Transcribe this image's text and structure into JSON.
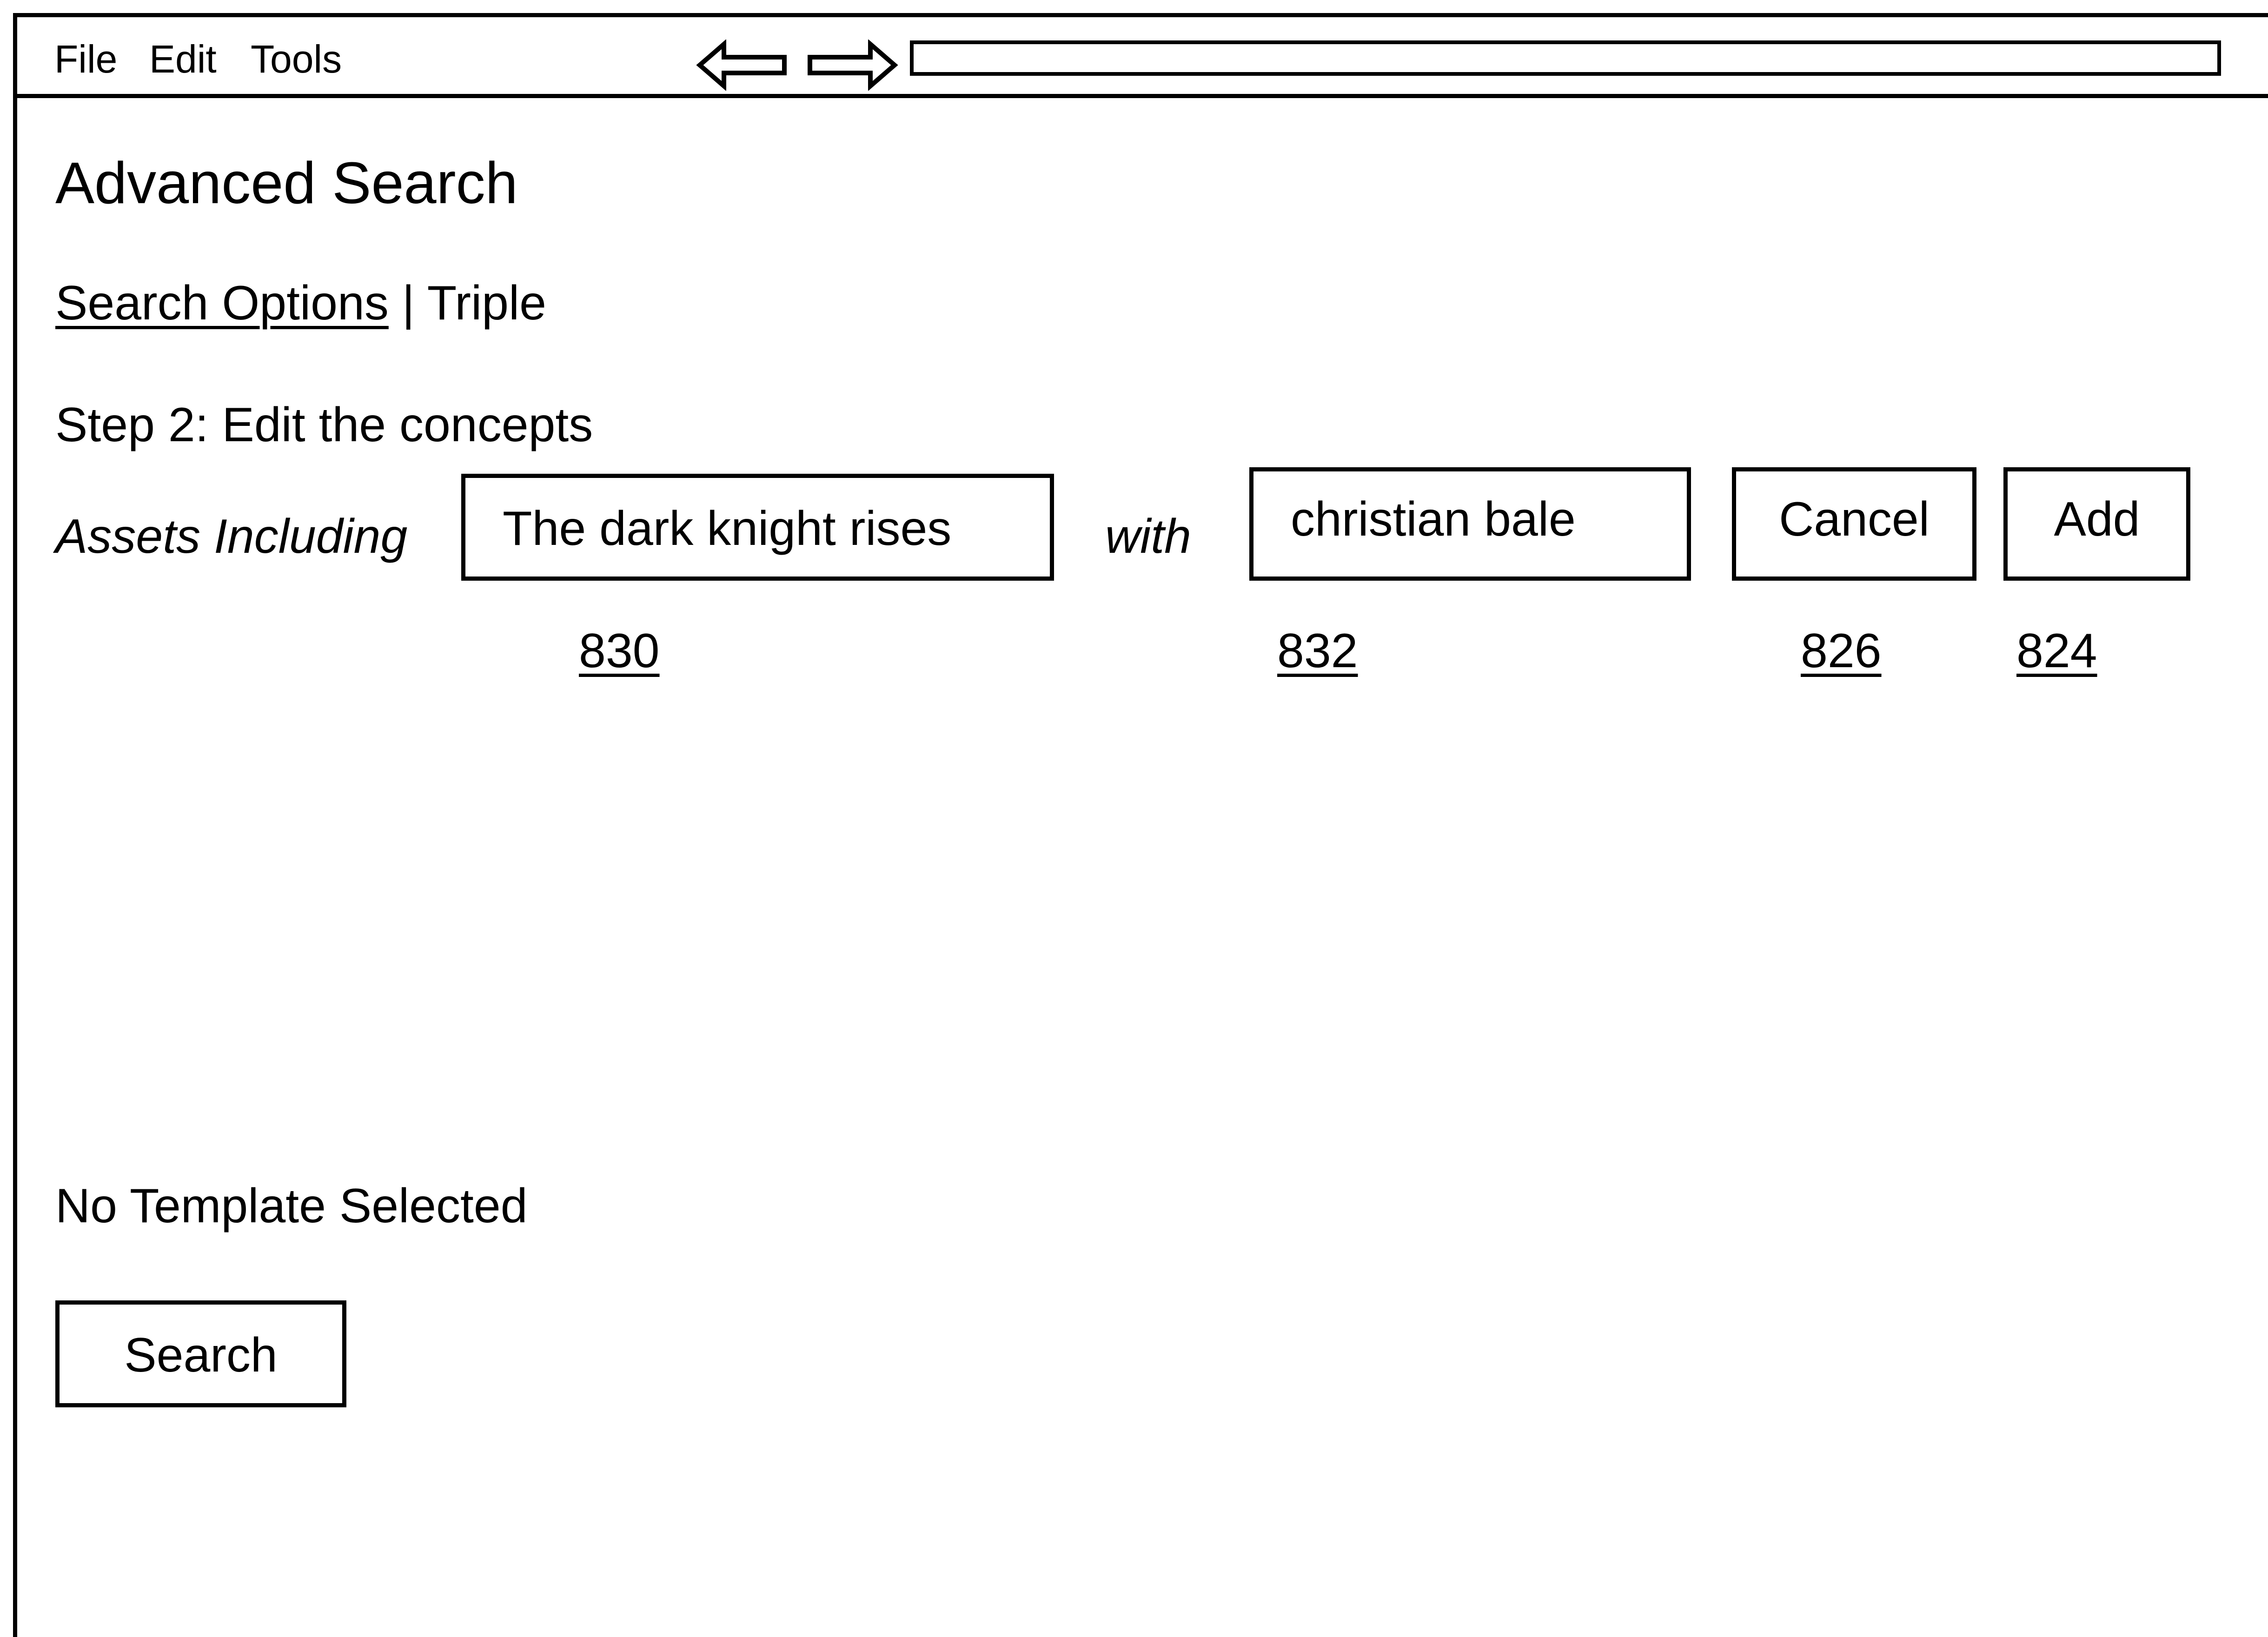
{
  "menubar": {
    "items": [
      "File",
      "Edit",
      "Tools"
    ],
    "back_icon": "left-arrow-icon",
    "forward_icon": "right-arrow-icon",
    "address_value": ""
  },
  "page": {
    "title": "Advanced Search",
    "breadcrumb": {
      "link": "Search Options",
      "separator": "|",
      "current": "Triple"
    },
    "step_label": "Step 2: Edit the concepts"
  },
  "concepts": {
    "assets_label": "Assets Including",
    "subject_value": "The dark knight rises",
    "connector": "with",
    "object_value": "christian bale",
    "cancel_label": "Cancel",
    "add_label": "Add"
  },
  "reference_numbers": {
    "subject": "830",
    "object": "832",
    "cancel": "826",
    "add": "824"
  },
  "status": {
    "template": "No Template Selected"
  },
  "search_button": {
    "label": "Search"
  }
}
